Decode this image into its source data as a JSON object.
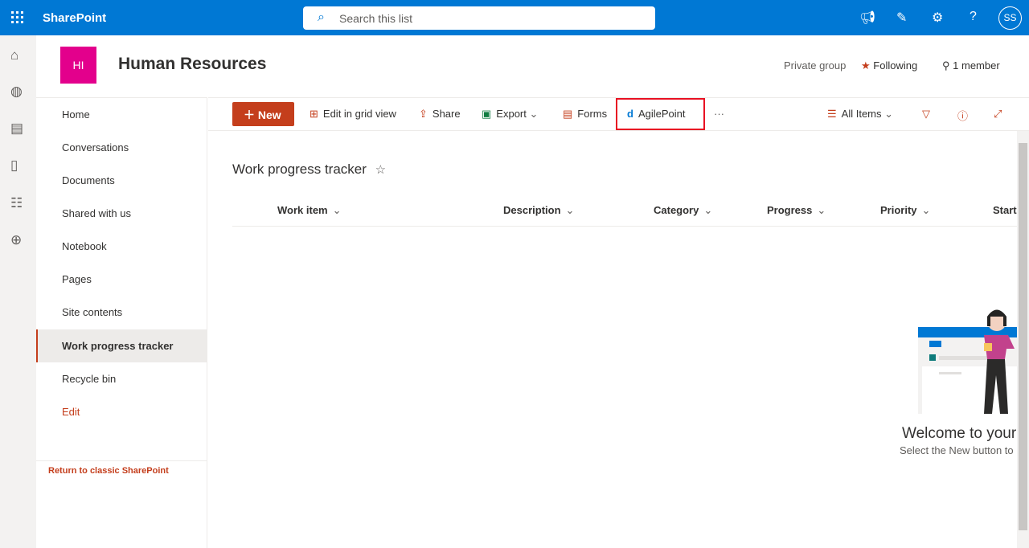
{
  "topbar": {
    "app": "SharePoint",
    "search_placeholder": "Search this list",
    "avatar": "SS",
    "icons": [
      "megaphone-icon",
      "feedback-icon",
      "gear-icon",
      "help-icon"
    ]
  },
  "site": {
    "logo": "HI",
    "title": "Human Resources",
    "privacy": "Private group",
    "following": "Following",
    "members": "1 member"
  },
  "nav": {
    "items": [
      "Home",
      "Conversations",
      "Documents",
      "Shared with us",
      "Notebook",
      "Pages",
      "Site contents",
      "Work progress tracker",
      "Recycle bin"
    ],
    "selected": "Work progress tracker",
    "edit": "Edit",
    "classic": "Return to classic SharePoint"
  },
  "commands": {
    "new": "New",
    "grid": "Edit in grid view",
    "share": "Share",
    "export": "Export",
    "forms": "Forms",
    "agilepoint": "AgilePoint",
    "more": "···",
    "view": "All Items"
  },
  "list": {
    "title": "Work progress tracker",
    "columns": [
      "Work item",
      "Description",
      "Category",
      "Progress",
      "Priority",
      "Start"
    ]
  },
  "empty": {
    "title": "Welcome to your",
    "subtitle": "Select the New button to"
  },
  "colors": {
    "brand": "#0078d4",
    "accent": "#c43e1c",
    "logo": "#e3008c",
    "highlight": "#e81123"
  }
}
